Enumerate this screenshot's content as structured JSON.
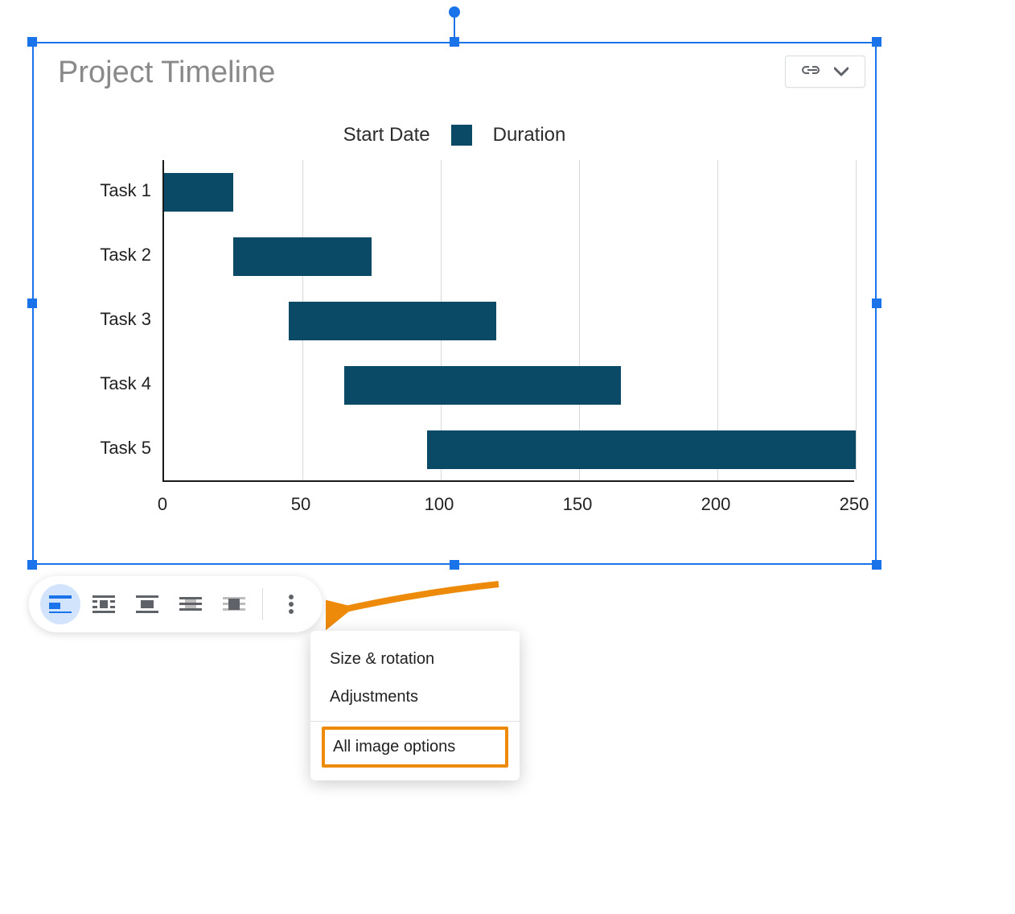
{
  "chart_title": "Project Timeline",
  "legend": {
    "start": "Start Date",
    "duration": "Duration"
  },
  "chart_data": {
    "type": "bar",
    "orientation": "horizontal",
    "stacked": true,
    "categories": [
      "Task 1",
      "Task 2",
      "Task 3",
      "Task 4",
      "Task 5"
    ],
    "series": [
      {
        "name": "Start Date",
        "values": [
          0,
          25,
          45,
          65,
          95
        ]
      },
      {
        "name": "Duration",
        "values": [
          25,
          50,
          75,
          100,
          155
        ]
      }
    ],
    "title": "Project Timeline",
    "xlabel": "",
    "ylabel": "",
    "xlim": [
      0,
      250
    ],
    "x_ticks": [
      0,
      50,
      100,
      150,
      200,
      250
    ],
    "series_colors": {
      "Start Date": "transparent",
      "Duration": "#0b4a66"
    }
  },
  "toolbar_buttons": [
    {
      "name": "inline-icon",
      "active": true
    },
    {
      "name": "wrap-text-icon",
      "active": false
    },
    {
      "name": "break-text-icon",
      "active": false
    },
    {
      "name": "behind-text-icon",
      "active": false
    },
    {
      "name": "in-front-of-text-icon",
      "active": false
    }
  ],
  "dropdown": {
    "items": [
      {
        "label": "Size & rotation",
        "highlighted": false
      },
      {
        "label": "Adjustments",
        "highlighted": false
      },
      {
        "label": "All image options",
        "highlighted": true
      }
    ]
  }
}
